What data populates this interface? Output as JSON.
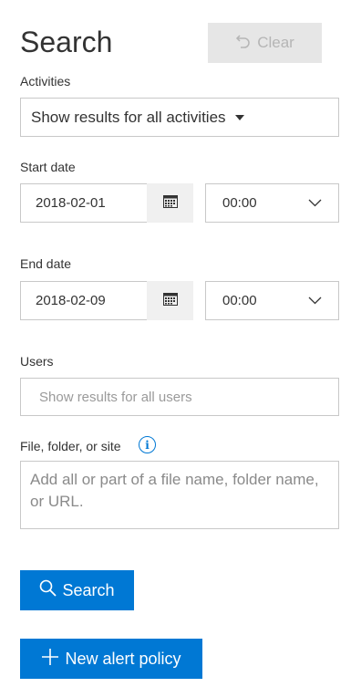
{
  "header": {
    "title": "Search",
    "clear_label": "Clear"
  },
  "activities": {
    "label": "Activities",
    "selected": "Show results for all activities"
  },
  "start_date": {
    "label": "Start date",
    "date": "2018-02-01",
    "time": "00:00"
  },
  "end_date": {
    "label": "End date",
    "date": "2018-02-09",
    "time": "00:00"
  },
  "users": {
    "label": "Users",
    "placeholder": "Show results for all users"
  },
  "file": {
    "label": "File, folder, or site",
    "placeholder": "Add all or part of a file name, folder name, or URL."
  },
  "actions": {
    "search_label": "Search",
    "alert_label": "New alert policy"
  },
  "icons": {
    "clear": "undo-icon",
    "calendar": "calendar-icon",
    "time_dropdown": "chevron-down-icon",
    "info": "info-icon",
    "search": "search-icon",
    "add": "plus-icon"
  },
  "colors": {
    "accent": "#0078d4",
    "disabled_bg": "#e6e6e6",
    "disabled_text": "#b5b5b5",
    "border": "#c8c8c8"
  }
}
